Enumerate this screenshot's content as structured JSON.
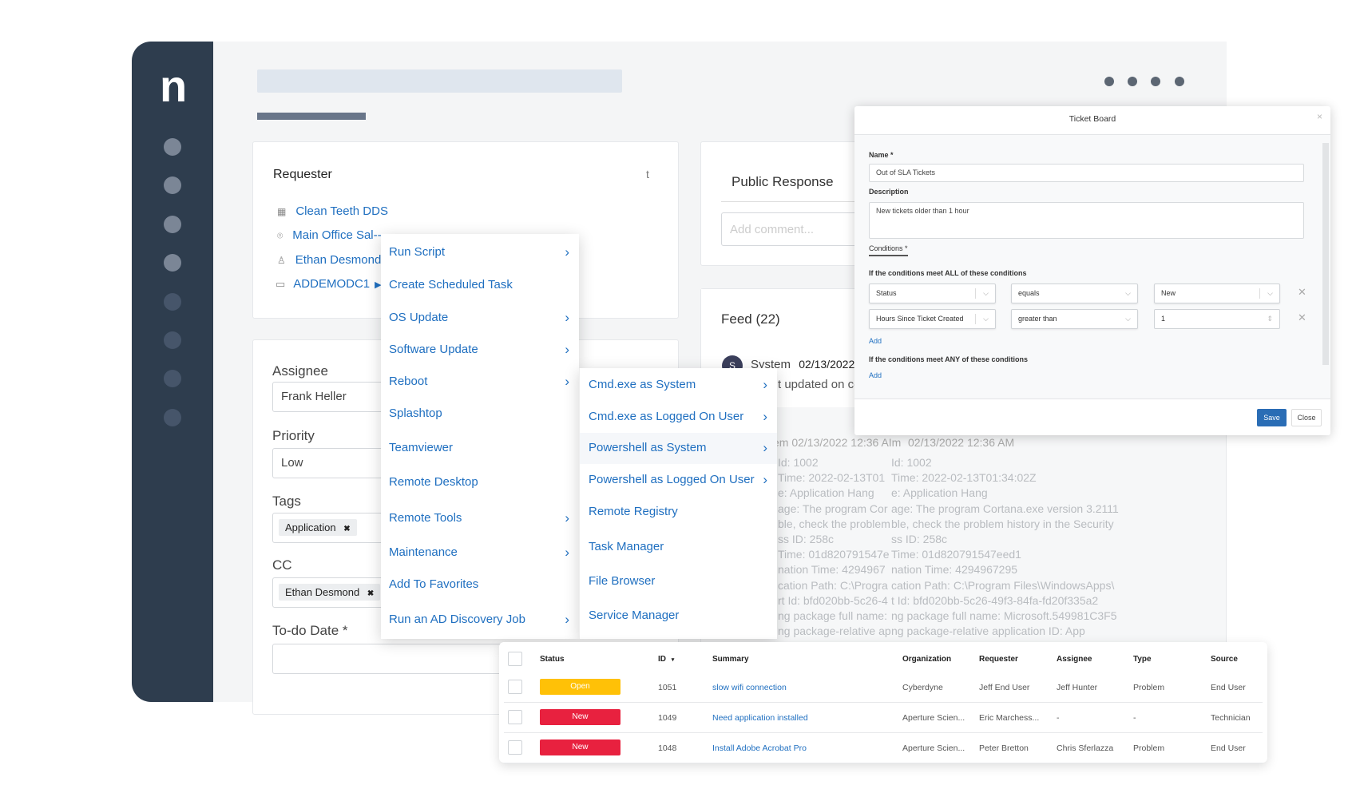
{
  "brand": {
    "logo": "n"
  },
  "requester": {
    "title": "Requester",
    "corner": "t",
    "items": [
      {
        "icon": "building-icon",
        "text": "Clean Teeth DDS"
      },
      {
        "icon": "location-pin-icon",
        "text": "Main Office Sal--"
      },
      {
        "icon": "user-icon",
        "text": "Ethan Desmond"
      },
      {
        "icon": "monitor-icon",
        "text": "ADDEMODC1"
      }
    ]
  },
  "details": {
    "assignee_label": "Assignee",
    "assignee": "Frank Heller",
    "priority_label": "Priority",
    "priority": "Low",
    "tags_label": "Tags",
    "tag": "Application",
    "cc_label": "CC",
    "cc": "Ethan Desmond",
    "todo_label": "To-do Date *",
    "chip_remove": "✖"
  },
  "public_response": {
    "title": "Public Response",
    "placeholder": "Add comment..."
  },
  "feed": {
    "title": "Feed (22)",
    "avatar": "S",
    "author": "System",
    "date": "02/13/2022",
    "snippet": "t updated on co",
    "header_a": "em  02/13/2022 12:36 AIm",
    "header_b": "02/13/2022 12:36 AM",
    "lines_a": [
      "Id: 1002",
      "Time: 2022-02-13T01",
      "e: Application Hang",
      "age: The program Cor",
      "ble, check the problem",
      "ss ID: 258c",
      "Time: 01d820791547e",
      "nation Time: 4294967",
      "cation Path: C:\\Progra",
      "rt Id: bfd020bb-5c26-4",
      "ng package full name:",
      "ng package-relative ap"
    ],
    "lines_b": [
      "Id: 1002",
      "Time: 2022-02-13T01:34:02Z",
      "e: Application Hang",
      "age: The program Cortana.exe version 3.2111",
      "ble, check the problem history in the Security",
      "ss ID: 258c",
      "Time: 01d820791547eed1",
      "nation Time: 4294967295",
      "cation Path: C:\\Program Files\\WindowsApps\\",
      "t Id: bfd020bb-5c26-49f3-84fa-fd20f335a2",
      "ng package full name: Microsoft.549981C3F5",
      "ng package-relative application ID: App"
    ]
  },
  "context_menu": {
    "items": [
      {
        "label": "Run Script",
        "submenu": true
      },
      {
        "label": "Create Scheduled Task",
        "submenu": false
      },
      {
        "label": "OS Update",
        "submenu": true
      },
      {
        "label": "Software Update",
        "submenu": true
      },
      {
        "label": "Reboot",
        "submenu": true
      },
      {
        "label": "Splashtop",
        "submenu": false
      },
      {
        "label": "Teamviewer",
        "submenu": false
      },
      {
        "label": "Remote Desktop",
        "submenu": false
      },
      {
        "label": "Remote Tools",
        "submenu": true
      },
      {
        "label": "Maintenance",
        "submenu": true
      },
      {
        "label": "Add To Favorites",
        "submenu": false
      },
      {
        "label": "Run an AD Discovery Job",
        "submenu": true
      }
    ]
  },
  "submenu": {
    "items": [
      {
        "label": "Cmd.exe as System",
        "submenu": true
      },
      {
        "label": "Cmd.exe as Logged On User",
        "submenu": true
      },
      {
        "label": "Powershell as System",
        "submenu": true,
        "hover": true
      },
      {
        "label": "Powershell as Logged On User",
        "submenu": true
      },
      {
        "label": "Remote Registry",
        "submenu": false
      },
      {
        "label": "Task Manager",
        "submenu": false
      },
      {
        "label": "File Browser",
        "submenu": false
      },
      {
        "label": "Service Manager",
        "submenu": false
      }
    ]
  },
  "modal": {
    "title": "Ticket Board",
    "close_icon": "×",
    "name_label": "Name *",
    "name_value": "Out of SLA Tickets",
    "desc_label": "Description",
    "desc_value": "New tickets older than 1 hour",
    "conditions_tab": "Conditions *",
    "all_label": "If the conditions meet ALL of these conditions",
    "any_label": "If the conditions meet ANY of these conditions",
    "add": "Add",
    "rows": [
      {
        "field": "Status",
        "op": "equals",
        "value": "New"
      },
      {
        "field": "Hours Since Ticket Created",
        "op": "greater than",
        "value": "1"
      }
    ],
    "save": "Save",
    "close": "Close"
  },
  "table": {
    "headers": {
      "status": "Status",
      "id": "ID",
      "summary": "Summary",
      "org": "Organization",
      "requester": "Requester",
      "assignee": "Assignee",
      "type": "Type",
      "source": "Source"
    },
    "rows": [
      {
        "status": "Open",
        "status_color": "#ffc107",
        "id": "1051",
        "summary": "slow wifi connection",
        "org": "Cyberdyne",
        "requester": "Jeff End User",
        "assignee": "Jeff Hunter",
        "type": "Problem",
        "source": "End User"
      },
      {
        "status": "New",
        "status_color": "#e8213f",
        "id": "1049",
        "summary": "Need application installed",
        "org": "Aperture Scien...",
        "requester": "Eric Marchess...",
        "assignee": "-",
        "type": "-",
        "source": "Technician"
      },
      {
        "status": "New",
        "status_color": "#e8213f",
        "id": "1048",
        "summary": "Install Adobe Acrobat Pro",
        "org": "Aperture Scien...",
        "requester": "Peter Bretton",
        "assignee": "Chris Sferlazza",
        "type": "Problem",
        "source": "End User"
      }
    ]
  },
  "colors": {
    "sidebar": "#2e3d4e",
    "link": "#1f6fc0",
    "save": "#2a6db5"
  }
}
